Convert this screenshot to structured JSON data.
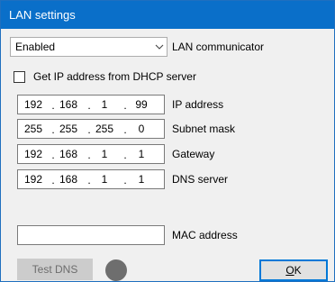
{
  "window": {
    "title": "LAN settings"
  },
  "communicator": {
    "selected": "Enabled",
    "label": "LAN communicator",
    "arrow_icon": "chevron-down-icon"
  },
  "dhcp": {
    "checked": false,
    "label": "Get IP address from DHCP server"
  },
  "ip_address": {
    "octets": [
      "192",
      "168",
      "1",
      "99"
    ],
    "label": "IP address"
  },
  "subnet_mask": {
    "octets": [
      "255",
      "255",
      "255",
      "0"
    ],
    "label": "Subnet mask"
  },
  "gateway": {
    "octets": [
      "192",
      "168",
      "1",
      "1"
    ],
    "label": "Gateway"
  },
  "dns_server": {
    "octets": [
      "192",
      "168",
      "1",
      "1"
    ],
    "label": "DNS server"
  },
  "separator": ".",
  "mac": {
    "value": "",
    "label": "MAC address"
  },
  "buttons": {
    "test_dns": "Test DNS",
    "ok_mnemonic": "O",
    "ok_rest": "K"
  },
  "colors": {
    "titlebar": "#0a6fc9",
    "status_led": "#6e6e6e",
    "ok_border": "#0078d7"
  }
}
